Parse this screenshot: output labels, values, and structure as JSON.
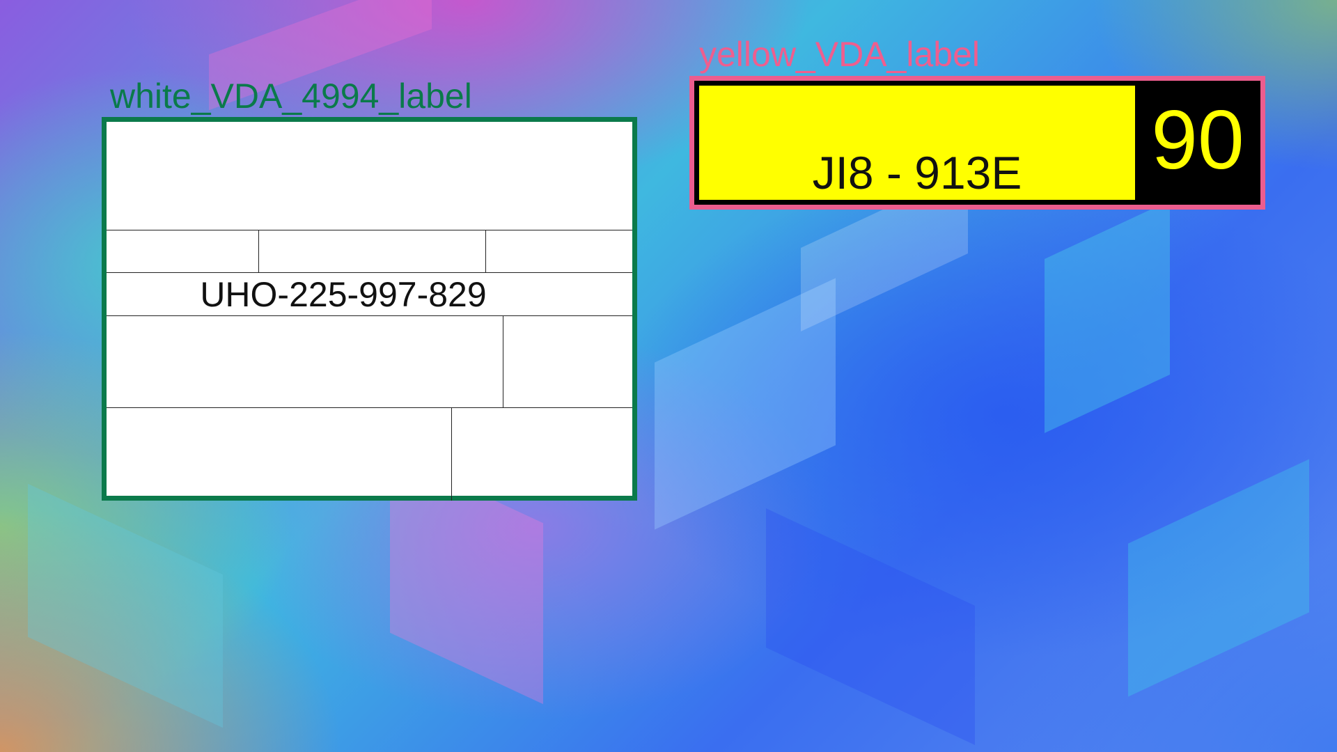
{
  "white_label": {
    "caption": "white_VDA_4994_label",
    "code": "UHO-225-997-829",
    "frame_color": "#0b7a4b"
  },
  "yellow_label": {
    "caption": "yellow_VDA_label",
    "code": "JI8 - 913E",
    "number": "90",
    "frame_color": "#ec5d8e"
  }
}
